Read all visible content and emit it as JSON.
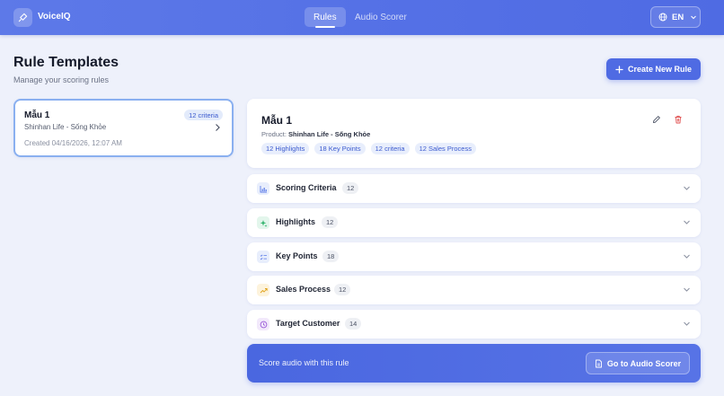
{
  "app": {
    "brand": "VoiceIQ",
    "nav": [
      {
        "label": "Rules",
        "active": true
      },
      {
        "label": "Audio Scorer",
        "active": false
      }
    ],
    "language": "EN"
  },
  "page": {
    "title": "Rule Templates",
    "subtitle": "Manage your scoring rules",
    "create_button": "Create New Rule"
  },
  "rule_list": [
    {
      "name": "Mẫu 1",
      "badge": "12 criteria",
      "product": "Shinhan Life - Sống Khỏe",
      "created": "Created 04/16/2026, 12:07 AM"
    }
  ],
  "detail": {
    "name": "Mẫu 1",
    "product_label": "Product:",
    "product_value": "Shinhan Life - Sống Khỏe",
    "tags": [
      "12 Highlights",
      "18 Key Points",
      "12 criteria",
      "12 Sales Process"
    ]
  },
  "sections": [
    {
      "label": "Scoring Criteria",
      "count": "12",
      "icon": "bar-chart-icon",
      "color": "#5b7be8",
      "bg": "#e8eefc"
    },
    {
      "label": "Highlights",
      "count": "12",
      "icon": "sparkle-icon",
      "color": "#2fb36b",
      "bg": "#e3f6ec"
    },
    {
      "label": "Key Points",
      "count": "18",
      "icon": "checklist-icon",
      "color": "#5b7be8",
      "bg": "#e8eefc"
    },
    {
      "label": "Sales Process",
      "count": "12",
      "icon": "trend-up-icon",
      "color": "#e0a21a",
      "bg": "#fdf3dc"
    },
    {
      "label": "Target Customer",
      "count": "14",
      "icon": "clock-icon",
      "color": "#9a5ad8",
      "bg": "#f2e9fb"
    }
  ],
  "score_banner": {
    "text": "Score audio with this rule",
    "button": "Go to Audio Scorer"
  },
  "colors": {
    "accent": "#4f6be3",
    "danger": "#e05252",
    "selected_border": "#8ab0f0"
  }
}
